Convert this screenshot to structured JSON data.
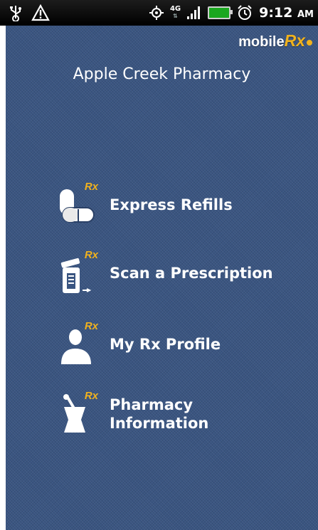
{
  "status_bar": {
    "time": "9:12",
    "ampm": "AM",
    "network": "4G",
    "icons": [
      "usb-icon",
      "warning-icon",
      "gps-icon",
      "signal-icon",
      "battery-icon",
      "alarm-icon"
    ]
  },
  "header": {
    "brand_main": "mobile",
    "brand_rx": "Rx",
    "title": "Apple Creek Pharmacy"
  },
  "menu": [
    {
      "label": "Express Refills",
      "icon": "pills-icon",
      "badge": "Rx"
    },
    {
      "label": "Scan a Prescription",
      "icon": "scan-bottle-icon",
      "badge": "Rx"
    },
    {
      "label": "My Rx Profile",
      "icon": "person-icon",
      "badge": "Rx"
    },
    {
      "label": "Pharmacy\nInformation",
      "icon": "mortar-pestle-icon",
      "badge": "Rx"
    }
  ],
  "colors": {
    "background": "#3a5581",
    "accent": "#f1b21d",
    "text": "#ffffff"
  }
}
